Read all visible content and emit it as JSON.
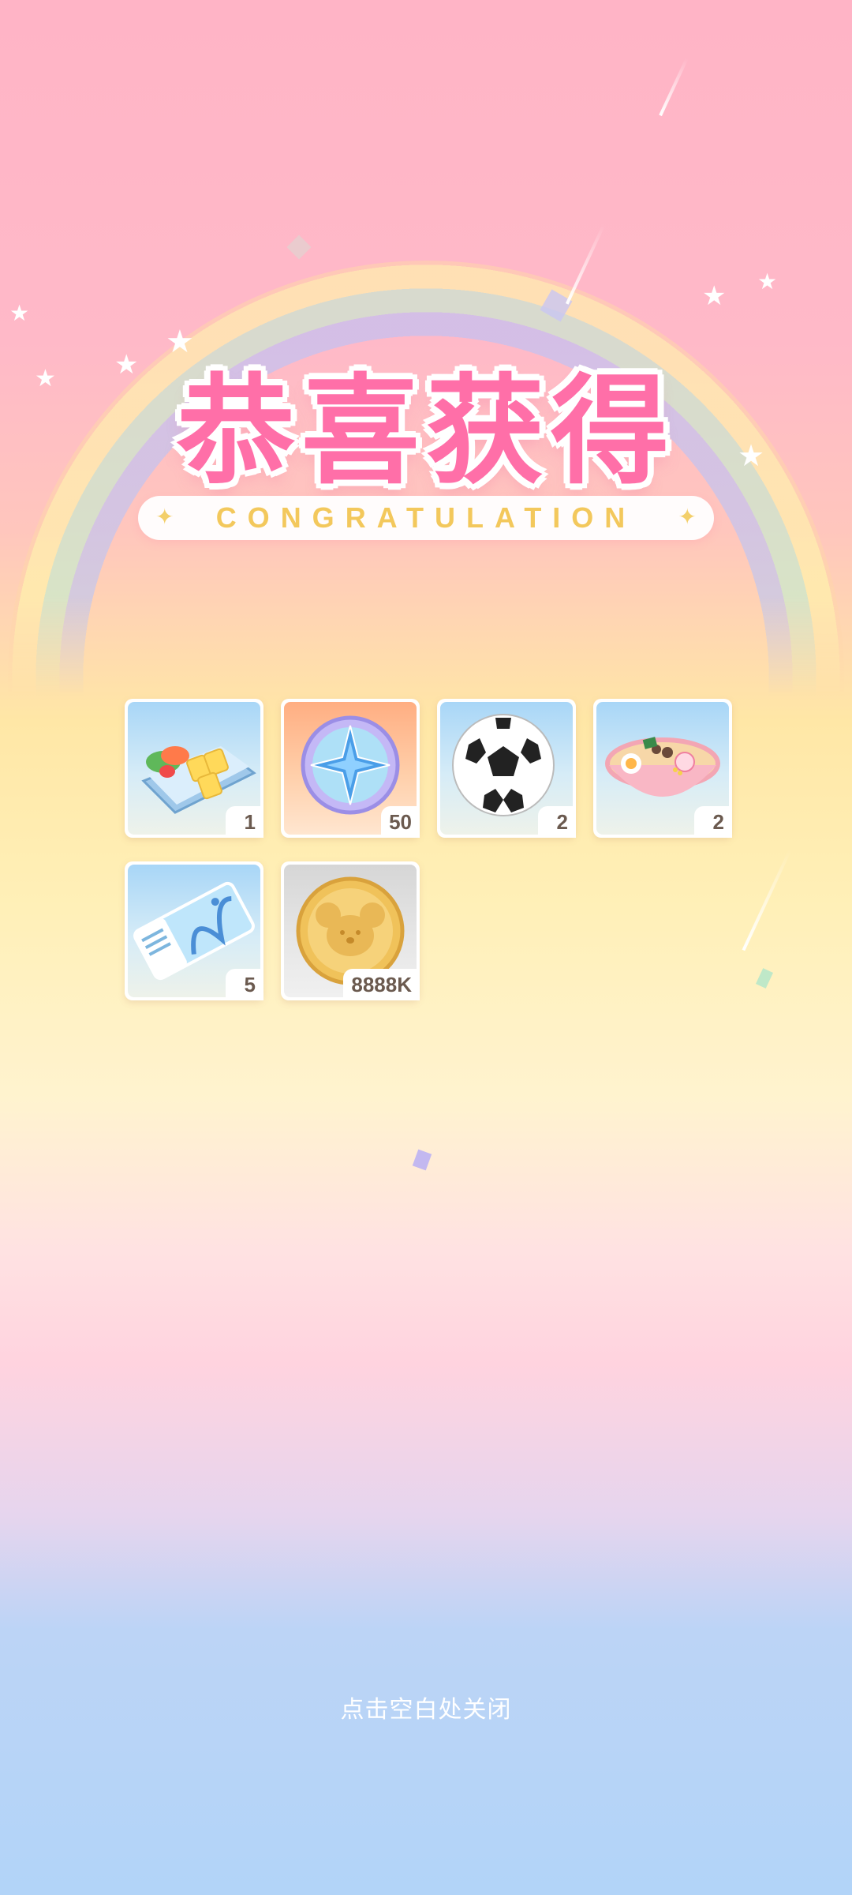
{
  "header": {
    "title": "恭喜获得",
    "subtitle": "CONGRATULATION"
  },
  "rewards": [
    {
      "name": "bento box",
      "icon": "bento-icon",
      "quantity": "1",
      "bg": "blue"
    },
    {
      "name": "compass coin",
      "icon": "compass-coin-icon",
      "quantity": "50",
      "bg": "orange"
    },
    {
      "name": "soccer ball",
      "icon": "soccer-ball-icon",
      "quantity": "2",
      "bg": "blue"
    },
    {
      "name": "ramen bowl",
      "icon": "ramen-icon",
      "quantity": "2",
      "bg": "blue"
    },
    {
      "name": "ticket",
      "icon": "ticket-icon",
      "quantity": "5",
      "bg": "blue"
    },
    {
      "name": "gold coin",
      "icon": "gold-coin-icon",
      "quantity": "8888K",
      "bg": "gray"
    }
  ],
  "footer": {
    "close_hint": "点击空白处关闭"
  },
  "colors": {
    "title_pink": "#ff6fa8",
    "subtitle_gold": "#f3c85c",
    "quantity_text": "#6b5a4f"
  }
}
